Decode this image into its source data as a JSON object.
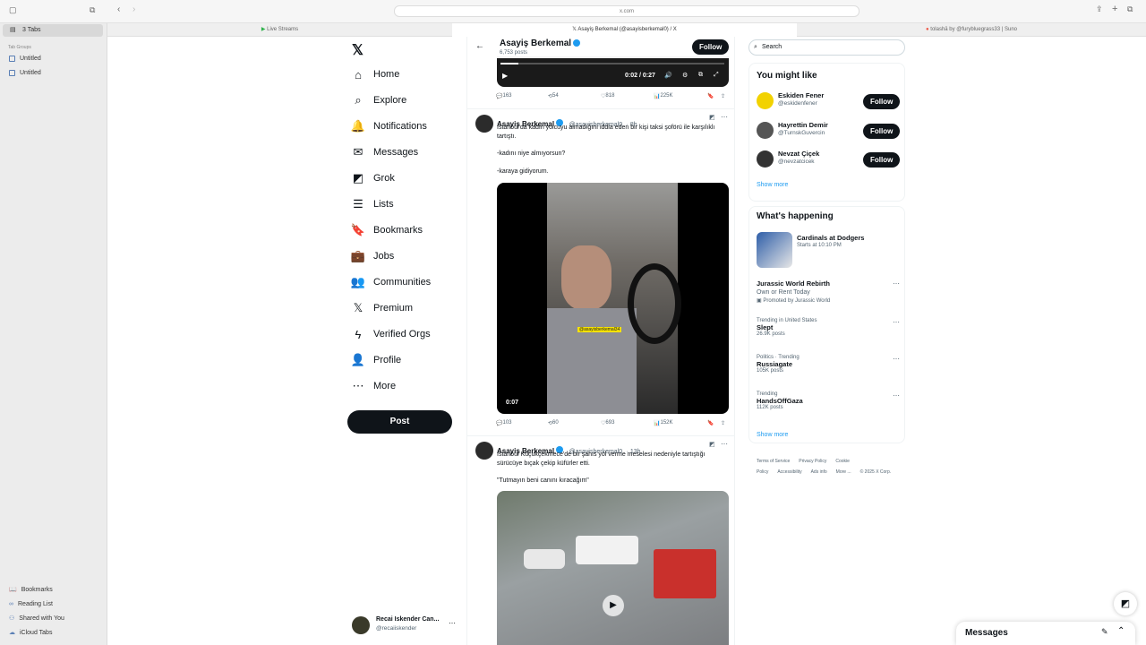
{
  "browser": {
    "url": "x.com",
    "tabs": [
      {
        "label": "Live Streams"
      },
      {
        "label": "Asayiş Berkemal (@asayisberkemal0) / X"
      },
      {
        "label": "tolashā by @furybluegrass33 | Suno"
      }
    ],
    "sidebar": {
      "tab_count": "3 Tabs",
      "tab_groups_label": "Tab Groups",
      "groups": [
        "Untitled",
        "Untitled"
      ],
      "bottom": [
        "Bookmarks",
        "Reading List",
        "Shared with You",
        "iCloud Tabs"
      ]
    }
  },
  "nav": {
    "items": [
      {
        "label": "Home",
        "icon": "⌂"
      },
      {
        "label": "Explore",
        "icon": "⌕"
      },
      {
        "label": "Notifications",
        "icon": "🔔"
      },
      {
        "label": "Messages",
        "icon": "✉"
      },
      {
        "label": "Grok",
        "icon": "◩"
      },
      {
        "label": "Lists",
        "icon": "☰"
      },
      {
        "label": "Bookmarks",
        "icon": "🔖"
      },
      {
        "label": "Jobs",
        "icon": "💼"
      },
      {
        "label": "Communities",
        "icon": "👥"
      },
      {
        "label": "Premium",
        "icon": "𝕏"
      },
      {
        "label": "Verified Orgs",
        "icon": "ϟ"
      },
      {
        "label": "Profile",
        "icon": "👤"
      },
      {
        "label": "More",
        "icon": "⋯"
      }
    ],
    "post_label": "Post",
    "account": {
      "name": "Recai Iskender Can...",
      "handle": "@recaiiskender"
    }
  },
  "profile_header": {
    "name": "Asayiş Berkemal",
    "posts": "6,753 posts",
    "follow_label": "Follow"
  },
  "video_player": {
    "time": "0:02 / 0:27"
  },
  "tweet0_actions": {
    "replies": "163",
    "reposts": "54",
    "likes": "818",
    "views": "225K"
  },
  "tweets": [
    {
      "name": "Asayiş Berkemal",
      "handle": "@asayisberkemal0",
      "time": "· 8h",
      "text": "İstanbul'da kadın yolcuyu almadığını iddia eden bir kişi taksi şoförü ile karşılıklı tartıştı.",
      "line2": "-kadını niye almıyorsun?",
      "line3": "-karaya gidiyorum.",
      "video_time": "0:07",
      "watermark": "@asayisberkemal34",
      "actions": {
        "replies": "103",
        "reposts": "60",
        "likes": "693",
        "views": "152K"
      }
    },
    {
      "name": "Asayiş Berkemal",
      "handle": "@asayisberkemal0",
      "time": "· 13h",
      "text": "İstanbul Küçükçekmece'de bir şahıs yol verme meselesi nedeniyle tartıştığı sürücüye bıçak çekip küfürler etti.",
      "line2": "\"Tutmayın beni canını kıracağım\""
    }
  ],
  "right": {
    "search_placeholder": "Search",
    "you_might_like": "You might like",
    "suggestions": [
      {
        "name": "Eskiden Fener",
        "handle": "@eskidenfener",
        "avatar_color": "#f2d200"
      },
      {
        "name": "Hayrettin Demir",
        "handle": "@TurnskGuvercin",
        "avatar_color": "#555555"
      },
      {
        "name": "Nevzat Çiçek",
        "handle": "@nevzatcicek",
        "avatar_color": "#333333"
      }
    ],
    "follow_label": "Follow",
    "show_more": "Show more",
    "whats_happening": "What's happening",
    "event": {
      "name": "Cardinals at Dodgers",
      "meta": "Starts at 10:10 PM"
    },
    "promo": {
      "name": "Jurassic World Rebirth",
      "sub": "Own or Rent Today",
      "promoted": "Promoted by Jurassic World"
    },
    "trends": [
      {
        "meta": "Trending in United States",
        "name": "Slept",
        "count": "26.9K posts"
      },
      {
        "meta": "Politics · Trending",
        "name": "Russiagate",
        "count": "105K posts"
      },
      {
        "meta": "Trending",
        "name": "HandsOffGaza",
        "count": "112K posts"
      }
    ],
    "footer": [
      "Terms of Service",
      "Privacy Policy",
      "Cookie Policy",
      "Accessibility",
      "Ads info",
      "More ...",
      "© 2025 X Corp."
    ]
  },
  "messages_drawer": {
    "label": "Messages"
  }
}
